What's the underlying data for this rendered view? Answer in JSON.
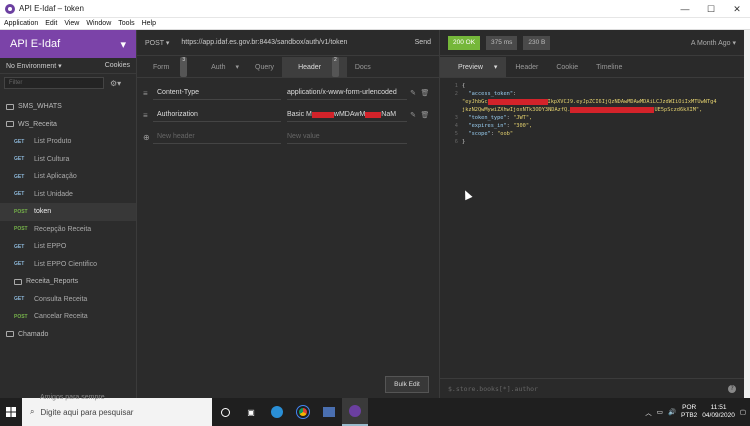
{
  "window": {
    "title": "API E-Idaf – token",
    "minimize": "—",
    "maximize": "☐",
    "close": "✕"
  },
  "menu": [
    "Application",
    "Edit",
    "View",
    "Window",
    "Tools",
    "Help"
  ],
  "sidebar": {
    "workspace": "API E-Idaf",
    "environment": "No Environment",
    "cookies": "Cookies",
    "filter_placeholder": "Filter",
    "items": [
      {
        "type": "folder",
        "label": "SMS_WHATS",
        "collapsed": true
      },
      {
        "type": "folder",
        "label": "WS_Receita",
        "collapsed": false
      },
      {
        "type": "req",
        "method": "GET",
        "label": "List Produto"
      },
      {
        "type": "req",
        "method": "GET",
        "label": "List Cultura"
      },
      {
        "type": "req",
        "method": "GET",
        "label": "List Aplicação"
      },
      {
        "type": "req",
        "method": "GET",
        "label": "List Unidade"
      },
      {
        "type": "req",
        "method": "POST",
        "label": "token",
        "active": true
      },
      {
        "type": "req",
        "method": "POST",
        "label": "Recepção Receita"
      },
      {
        "type": "req",
        "method": "GET",
        "label": "List EPPO"
      },
      {
        "type": "req",
        "method": "GET",
        "label": "List EPPO Cientifico"
      },
      {
        "type": "folder",
        "label": "Receita_Reports",
        "collapsed": true,
        "indent": true
      },
      {
        "type": "req",
        "method": "GET",
        "label": "Consulta Receita"
      },
      {
        "type": "req",
        "method": "POST",
        "label": "Cancelar Receita"
      },
      {
        "type": "folder",
        "label": "Chamado",
        "collapsed": true
      }
    ]
  },
  "request": {
    "method": "POST",
    "url": "https://app.idaf.es.gov.br:8443/sandbox/auth/v1/token",
    "send": "Send",
    "tabs": [
      {
        "label": "Form",
        "count": "3"
      },
      {
        "label": "Auth",
        "count": ""
      },
      {
        "label": "Query",
        "count": ""
      },
      {
        "label": "Header",
        "count": "2",
        "active": true
      },
      {
        "label": "Docs",
        "count": ""
      }
    ],
    "headers": [
      {
        "key": "Content-Type",
        "value": "application/x-www-form-urlencoded"
      },
      {
        "key": "Authorization",
        "value_prefix": "Basic M",
        "value_mid": "wMDAwM",
        "value_suffix": "NaM"
      }
    ],
    "new_header_placeholder": "New header",
    "new_value_placeholder": "New value",
    "bulk_edit": "Bulk Edit"
  },
  "response": {
    "status": "200 OK",
    "time": "375 ms",
    "size": "230 B",
    "age": "A Month Ago",
    "tabs": [
      "Preview",
      "Header",
      "Cookie",
      "Timeline"
    ],
    "body_lines": [
      {
        "n": "1",
        "text": "{"
      },
      {
        "n": "2",
        "key": "\"access_token\"",
        "text": ":"
      },
      {
        "n": "",
        "str_a": "\"eyJhbGc",
        "str_b": "IkpXVCJ9.eyJpZCI6IjQzNDAwMDAwMDAiLCJzdWIiOiIxMTUwNTg4",
        "redacted": true
      },
      {
        "n": "",
        "str_a": "jkzN2QwMywiZXhwIjoxNTk3ODY3NDAzfQ.",
        "str_b": "UE5pSczd6kXIM\",",
        "redacted": true
      },
      {
        "n": "3",
        "key": "\"token_type\"",
        "value": "\"JWT\","
      },
      {
        "n": "4",
        "key": "\"expires_in\"",
        "value": "\"300\","
      },
      {
        "n": "5",
        "key": "\"scope\"",
        "value": "\"oob\""
      },
      {
        "n": "6",
        "text": "}"
      }
    ],
    "filter_placeholder": "$.store.books[*].author"
  },
  "taskbar": {
    "search_placeholder": "Digite aqui para pesquisar",
    "lang": "POR",
    "layout": "PTB2",
    "time": "11:51",
    "date": "04/09/2020",
    "notification_snippet": "Amigos para sempre"
  },
  "colors": {
    "accent": "#7b43a8",
    "status_ok": "#75b73a",
    "redaction": "#d3232a"
  }
}
